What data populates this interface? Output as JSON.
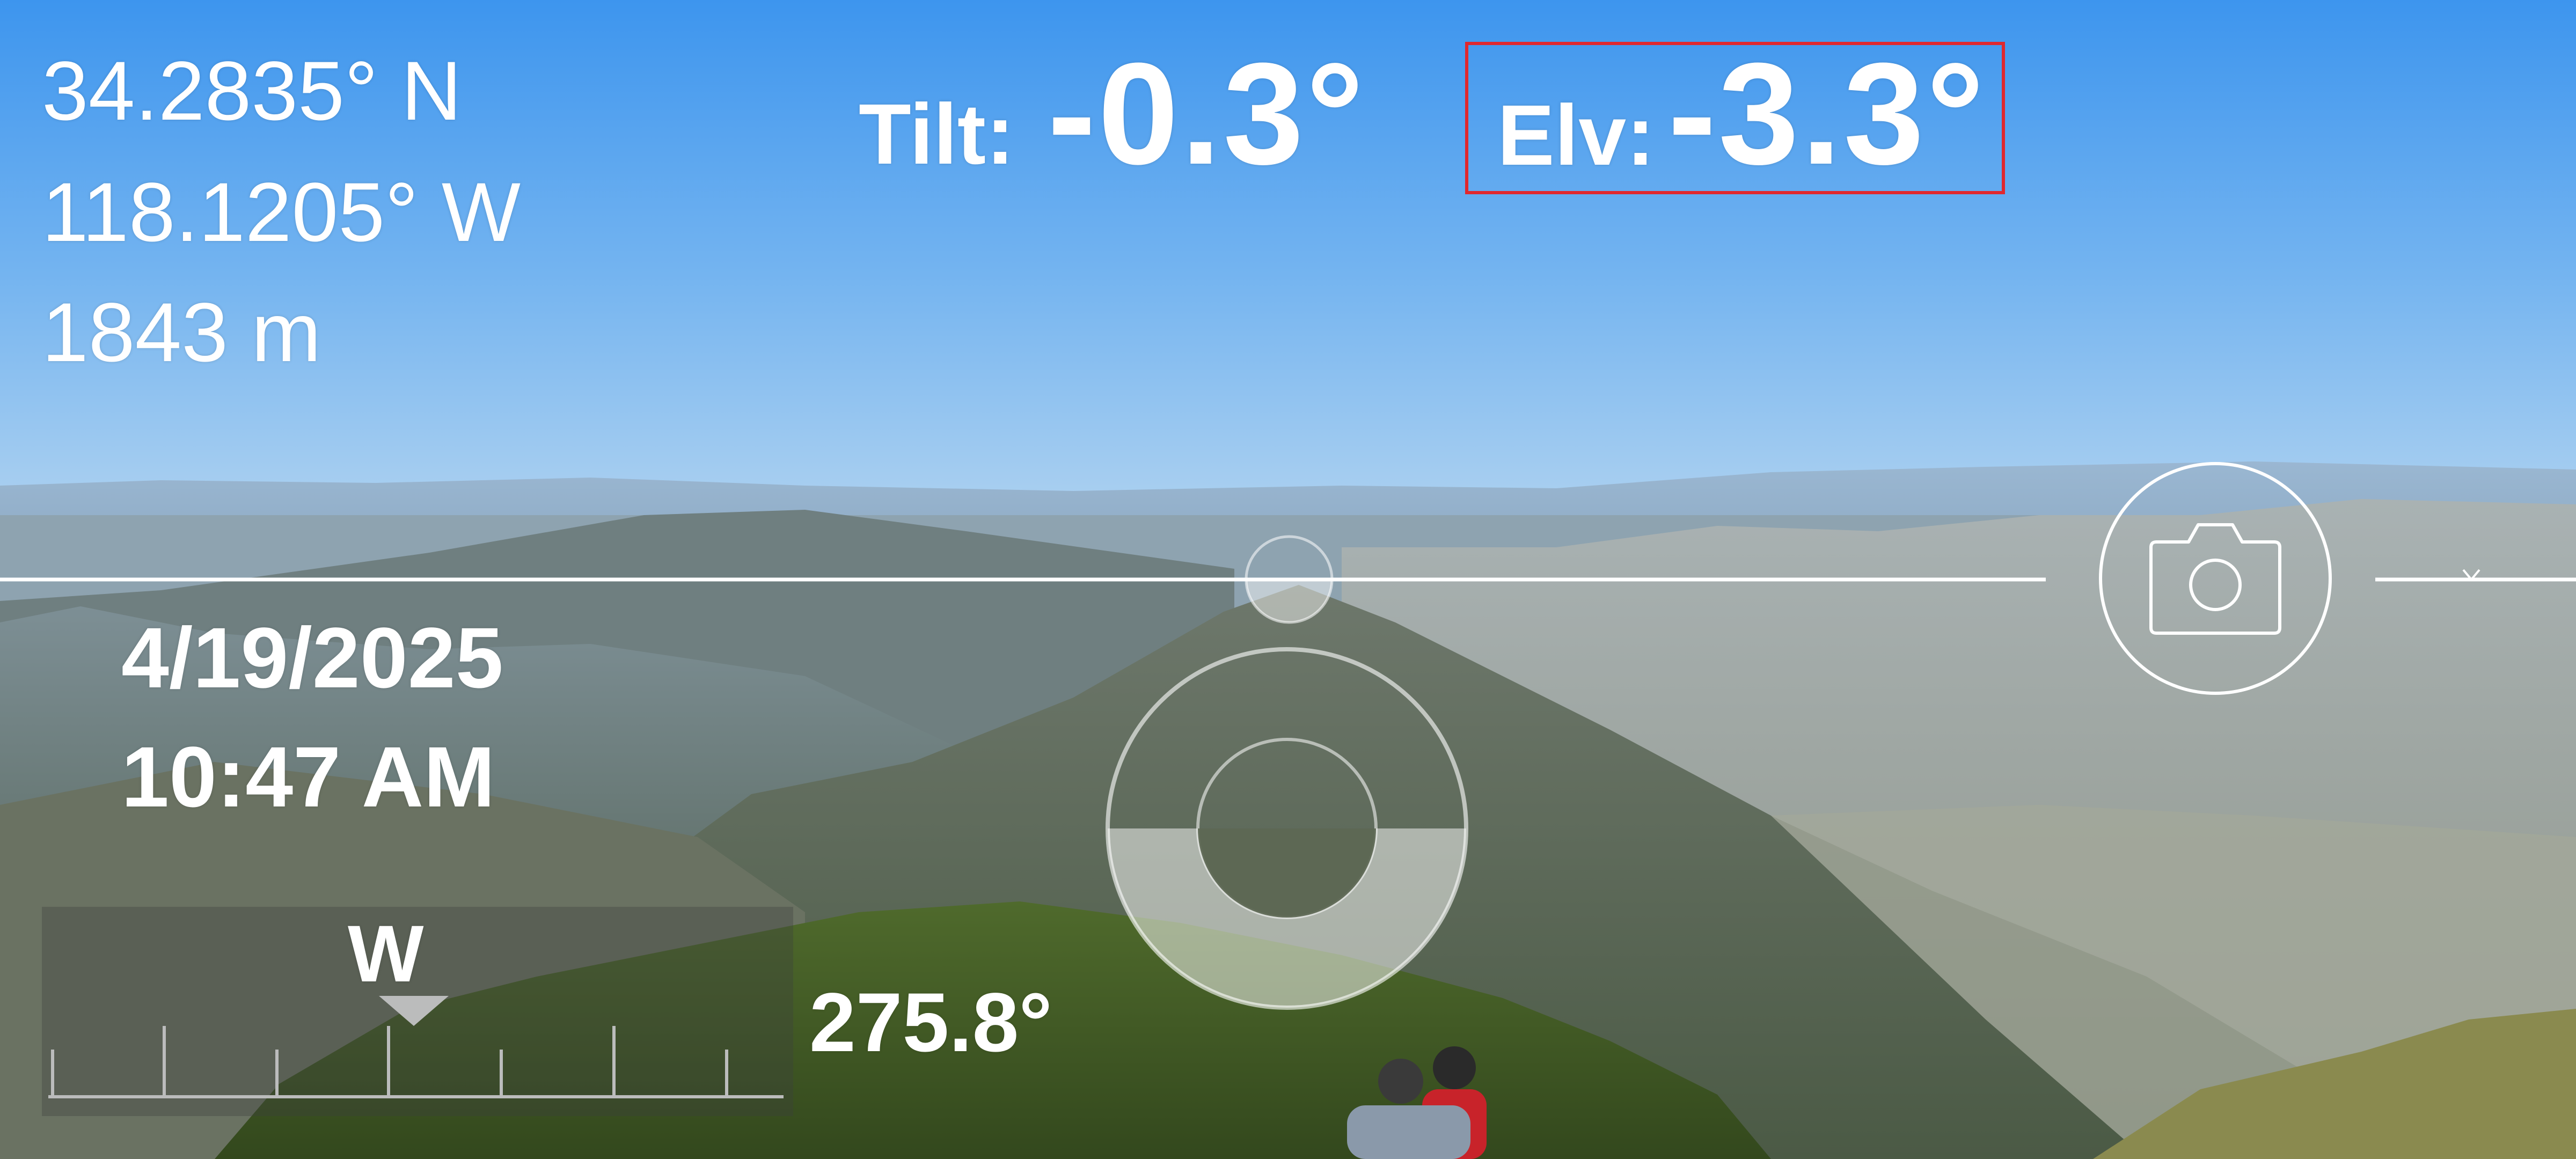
{
  "location": {
    "latitude": "34.2835° N",
    "longitude": "118.1205° W",
    "altitude": "1843 m"
  },
  "readings": {
    "tilt_label": "Tilt:",
    "tilt_value": "-0.3°",
    "elevation_label": "Elv:",
    "elevation_value": "-3.3°"
  },
  "timestamp": {
    "date": "4/19/2025",
    "time": "10:47 AM"
  },
  "compass": {
    "direction_letter": "W",
    "heading": "275.8°"
  },
  "colors": {
    "overlay_text": "#ffffff",
    "highlight_box": "#e0282e",
    "sky_top": "#3d95ee",
    "sky_horizon": "#a9cff0"
  },
  "icons": {
    "camera": "camera-icon",
    "level": "bubble-level-icon",
    "pointer": "compass-pointer-icon"
  }
}
